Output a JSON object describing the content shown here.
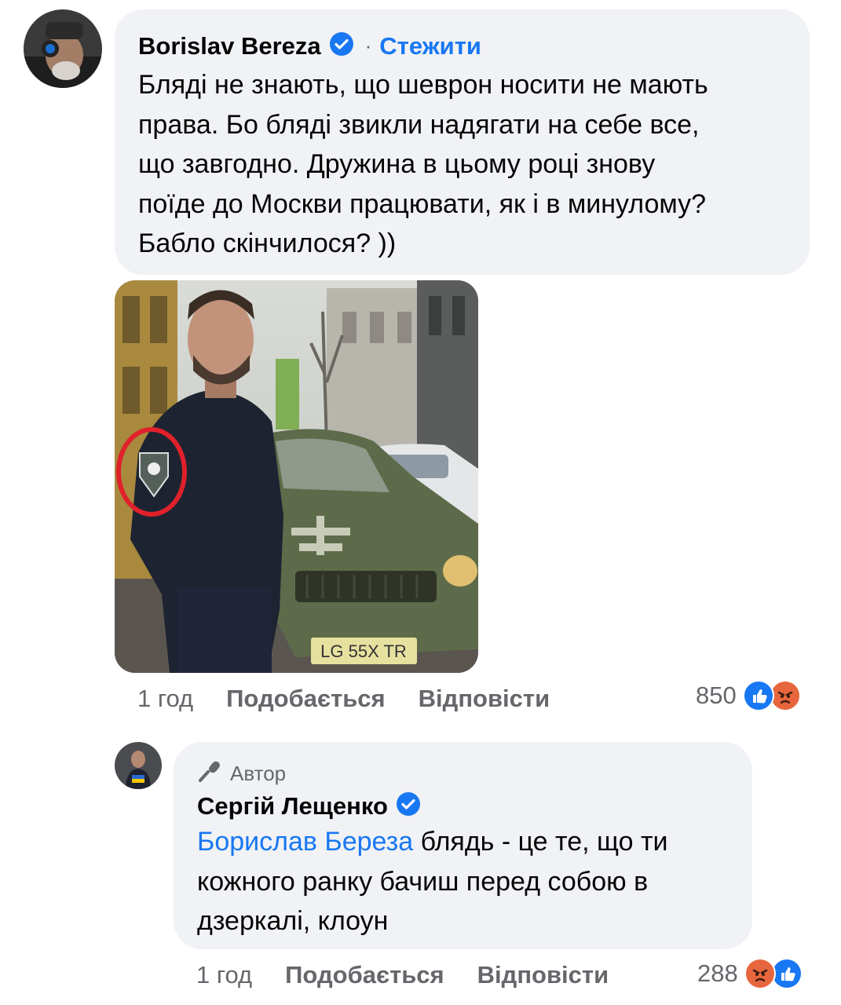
{
  "comment1": {
    "author": "Borislav Bereza",
    "separator": "·",
    "follow_label": "Стежити",
    "lines": [
      "Бляді не знають, що шеврон носити не мають",
      "права. Бо бляді звикли надягати на себе все,",
      "що завгодно. Дружина в цьому році знову",
      "поїде до Москви працювати, як і в минулому?",
      "Бабло скінчилося? ))"
    ],
    "photo_plate": "LG 55X TR",
    "time": "1 год",
    "like_label": "Подобається",
    "reply_label": "Відповісти",
    "reaction_count": "850",
    "reaction_icons": [
      "like-icon",
      "angry-icon"
    ]
  },
  "comment2": {
    "badge_label": "Автор",
    "author": "Сергій Лещенко",
    "mention": "Борислав Береза",
    "line1_rest": " блядь - це те, що ти",
    "lines": [
      "кожного ранку бачиш перед собою в",
      "дзеркалі, клоун"
    ],
    "time": "1 год",
    "like_label": "Подобається",
    "reply_label": "Відповісти",
    "reaction_count": "288",
    "reaction_icons": [
      "angry-icon",
      "like-icon"
    ]
  },
  "colors": {
    "accent": "#1877f2",
    "bubble": "#f0f2f5",
    "meta": "#65676b",
    "highlight_circle": "#e0212b"
  }
}
